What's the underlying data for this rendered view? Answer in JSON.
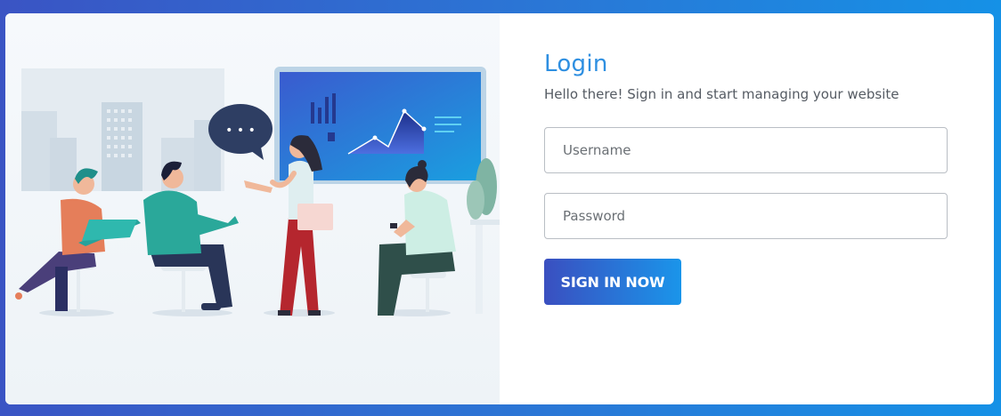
{
  "login": {
    "title": "Login",
    "subtitle": "Hello there! Sign in and start managing your website",
    "username_placeholder": "Username",
    "password_placeholder": "Password",
    "submit_label": "SIGN IN NOW"
  },
  "illustration": {
    "icon": "team-meeting-illustration",
    "speech_bubble_text": "• • •"
  },
  "colors": {
    "accent": "#2e8fe1",
    "button_start": "#3a4fc0",
    "button_end": "#1a95ea",
    "frame_start": "#3a54c4",
    "frame_end": "#1591e6"
  }
}
